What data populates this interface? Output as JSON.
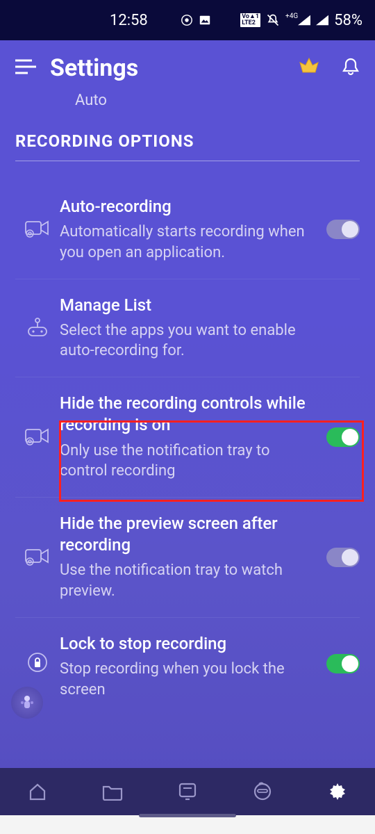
{
  "statusbar": {
    "time": "12:58",
    "battery": "58%",
    "net_4g": "4G",
    "volte": "Vo)LTE"
  },
  "header": {
    "title": "Settings"
  },
  "partial": "Auto",
  "section_title": "RECORDING OPTIONS",
  "items": [
    {
      "title": "Auto-recording",
      "sub": "Automatically starts recording when you open an application.",
      "toggle": "off"
    },
    {
      "title": "Manage List",
      "sub": "Select the apps you want to enable auto-recording for."
    },
    {
      "title": "Hide the recording controls while recording is on",
      "sub": "Only use the notification tray to control recording",
      "toggle": "on"
    },
    {
      "title": "Hide the preview screen after recording",
      "sub": "Use the notification tray to watch preview.",
      "toggle": "off"
    },
    {
      "title": "Lock to stop recording",
      "sub": "Stop recording when you lock the screen",
      "toggle": "on"
    }
  ]
}
